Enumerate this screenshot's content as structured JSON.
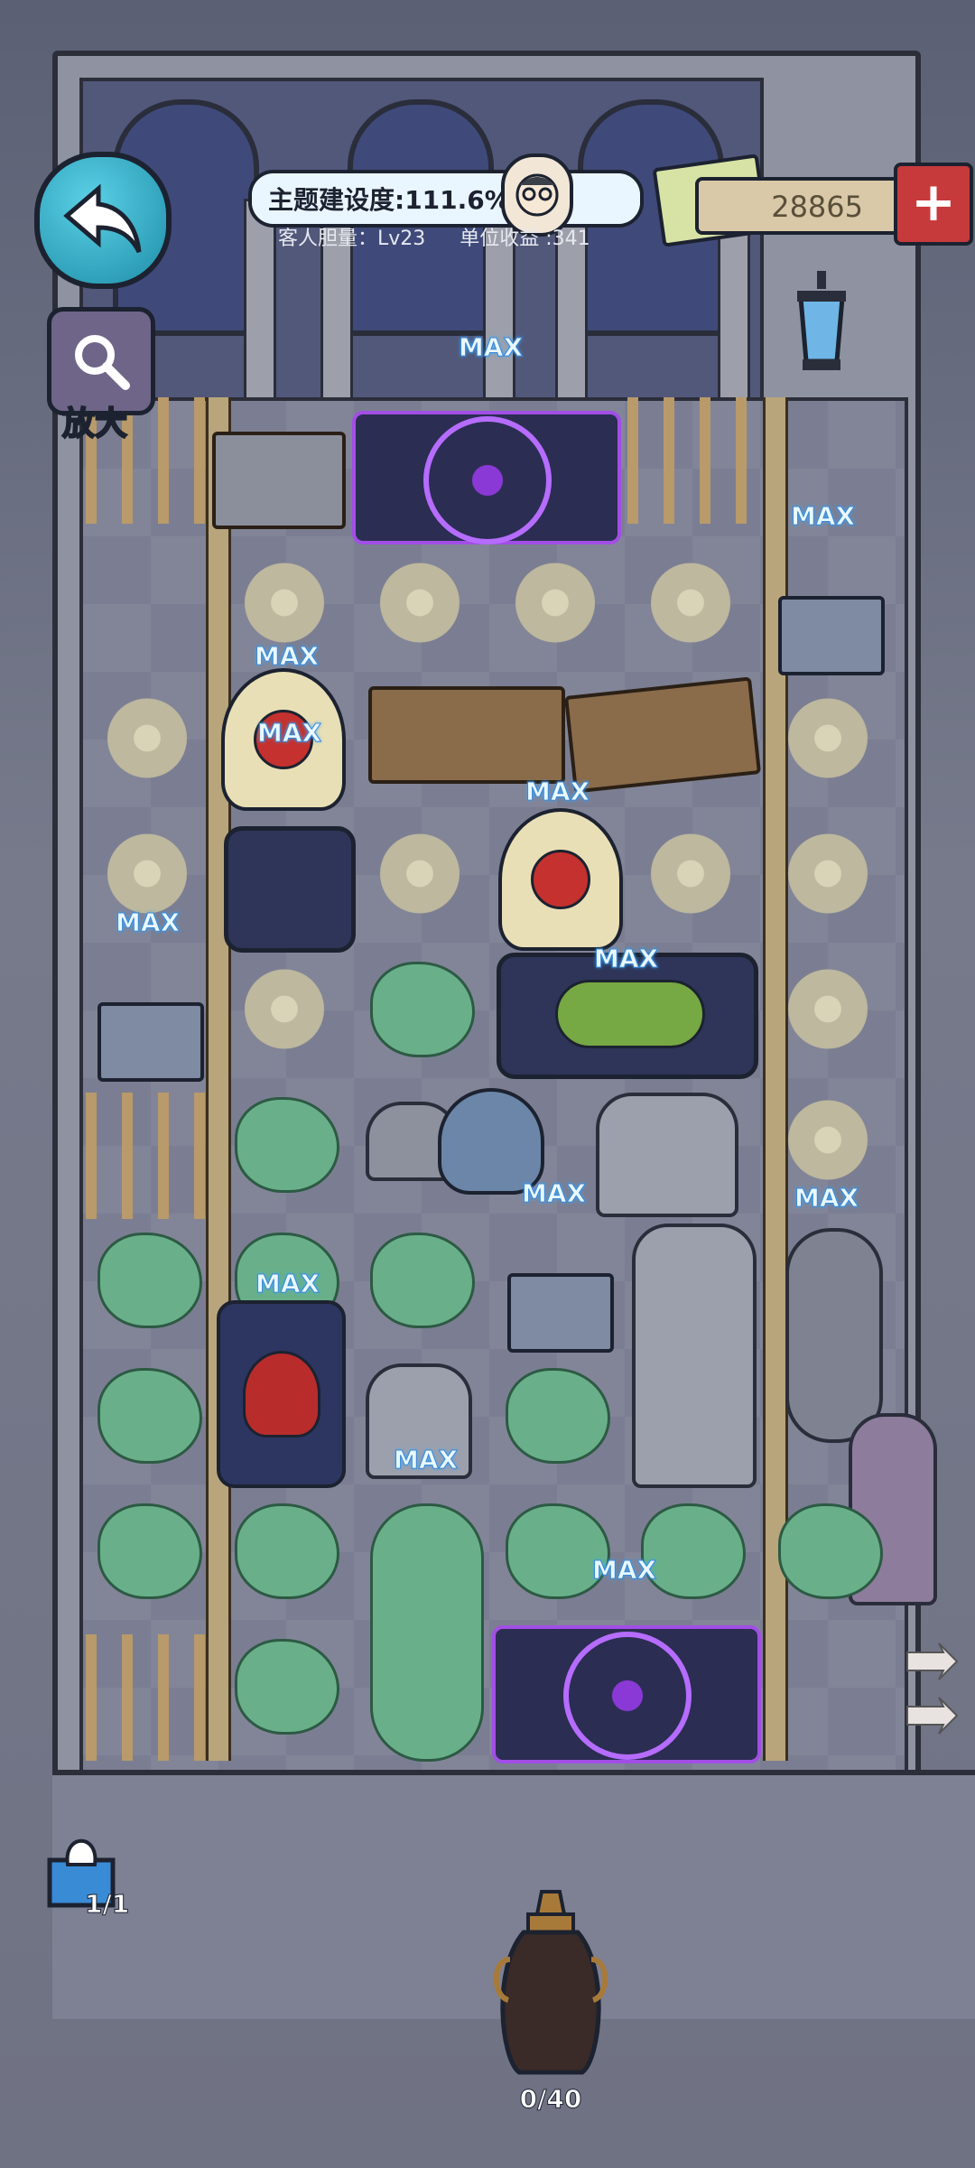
{
  "hud": {
    "progress_label": "主题建设度:111.6%",
    "progress_fraction": 1.0,
    "guest_courage": "客人胆量：Lv23",
    "unit_income": "单位收益 :341",
    "money": "28865",
    "zoom_label": "放大"
  },
  "tile_labels": {
    "max": "MAX"
  },
  "bottom": {
    "ghost_count": "1/1",
    "urn_count": "0/40"
  },
  "colors": {
    "accent_cyan": "#5ad0e6",
    "magic_purple": "#b56cff",
    "plus_red": "#c73a3c",
    "slime_green": "#69b08a"
  }
}
